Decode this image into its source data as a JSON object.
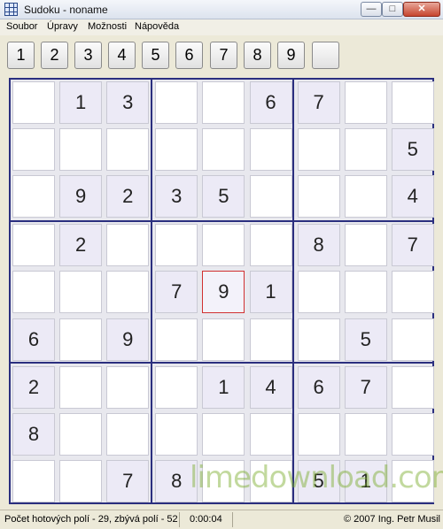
{
  "window": {
    "title": "Sudoku - noname",
    "min_glyph": "—",
    "max_glyph": "□",
    "close_glyph": "✕"
  },
  "menu": [
    "Soubor",
    "Úpravy",
    "Možnosti",
    "Nápověda"
  ],
  "toolbar": {
    "numbers": [
      "1",
      "2",
      "3",
      "4",
      "5",
      "6",
      "7",
      "8",
      "9"
    ],
    "clear_label": ""
  },
  "board": {
    "rows": [
      [
        "",
        "1",
        "3",
        "",
        "",
        "6",
        "7",
        "",
        ""
      ],
      [
        "",
        "",
        "",
        "",
        "",
        "",
        "",
        "",
        "5"
      ],
      [
        "",
        "9",
        "2",
        "3",
        "5",
        "",
        "",
        "",
        "4"
      ],
      [
        "",
        "2",
        "",
        "",
        "",
        "",
        "8",
        "",
        "7"
      ],
      [
        "",
        "",
        "",
        "7",
        "9",
        "1",
        "",
        "",
        ""
      ],
      [
        "6",
        "",
        "9",
        "",
        "",
        "",
        "",
        "5",
        ""
      ],
      [
        "2",
        "",
        "",
        "",
        "1",
        "4",
        "6",
        "7",
        ""
      ],
      [
        "8",
        "",
        "",
        "",
        "",
        "",
        "",
        "",
        ""
      ],
      [
        "",
        "",
        "7",
        "8",
        "",
        "",
        "5",
        "1",
        ""
      ]
    ],
    "selected": {
      "row": 4,
      "col": 4
    }
  },
  "status": {
    "progress": "Počet hotových polí - 29, zbývá polí - 52",
    "time": "0:00:04",
    "copyright": "© 2007 Ing. Petr Musil"
  },
  "watermark": "limedownload.com"
}
